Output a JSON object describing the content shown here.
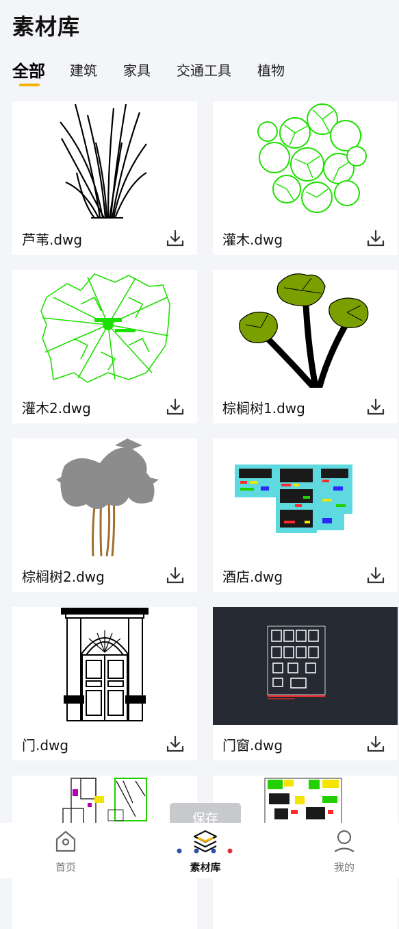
{
  "header": {
    "title": "素材库"
  },
  "tabs": [
    {
      "label": "全部",
      "active": true
    },
    {
      "label": "建筑",
      "active": false
    },
    {
      "label": "家具",
      "active": false
    },
    {
      "label": "交通工具",
      "active": false
    },
    {
      "label": "植物",
      "active": false
    }
  ],
  "items": [
    {
      "name": "芦苇.dwg",
      "thumb": "reed-drawing"
    },
    {
      "name": "灌木.dwg",
      "thumb": "shrub-drawing"
    },
    {
      "name": "灌木2.dwg",
      "thumb": "shrub2-drawing"
    },
    {
      "name": "棕榈树1.dwg",
      "thumb": "palm1-drawing"
    },
    {
      "name": "棕榈树2.dwg",
      "thumb": "palm2-drawing"
    },
    {
      "name": "酒店.dwg",
      "thumb": "hotel-plan-drawing"
    },
    {
      "name": "门.dwg",
      "thumb": "door-drawing"
    },
    {
      "name": "门窗.dwg",
      "thumb": "doors-windows-drawing"
    },
    {
      "name": "",
      "thumb": "floor-plan-drawing"
    },
    {
      "name": "",
      "thumb": "colored-plan-drawing"
    }
  ],
  "save_button": {
    "label": "保存"
  },
  "tabbar": [
    {
      "label": "首页",
      "icon": "home-icon",
      "active": false
    },
    {
      "label": "素材库",
      "icon": "layers-icon",
      "active": true
    },
    {
      "label": "我的",
      "icon": "user-icon",
      "active": false
    }
  ],
  "colors": {
    "accent": "#f2b400",
    "green": "#22e000",
    "olive": "#7aa000",
    "dark_thumb": "#252a33"
  }
}
